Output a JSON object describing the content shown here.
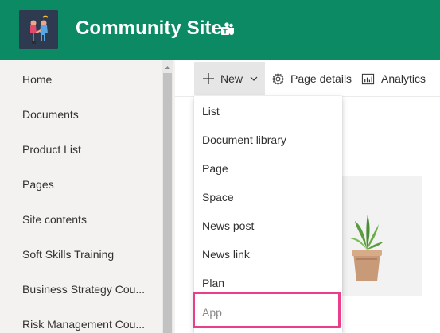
{
  "header": {
    "site_title": "Community Site",
    "background_color": "#0b8a64",
    "logo_icon": "people-handshake-logo",
    "teams_icon": "teams-icon"
  },
  "sidebar": {
    "items": [
      {
        "label": "Home"
      },
      {
        "label": "Documents"
      },
      {
        "label": "Product List"
      },
      {
        "label": "Pages"
      },
      {
        "label": "Site contents"
      },
      {
        "label": "Soft Skills Training"
      },
      {
        "label": "Business Strategy Cou..."
      },
      {
        "label": "Risk Management Cou..."
      }
    ]
  },
  "command_bar": {
    "new_label": "New",
    "page_details_label": "Page details",
    "analytics_label": "Analytics"
  },
  "new_menu": {
    "items": [
      {
        "label": "List",
        "enabled": true
      },
      {
        "label": "Document library",
        "enabled": true
      },
      {
        "label": "Page",
        "enabled": true
      },
      {
        "label": "Space",
        "enabled": true
      },
      {
        "label": "News post",
        "enabled": true
      },
      {
        "label": "News link",
        "enabled": true
      },
      {
        "label": "Plan",
        "enabled": true
      },
      {
        "label": "App",
        "enabled": false
      }
    ],
    "highlighted_item": "App",
    "highlight_color": "#e83e8c"
  }
}
